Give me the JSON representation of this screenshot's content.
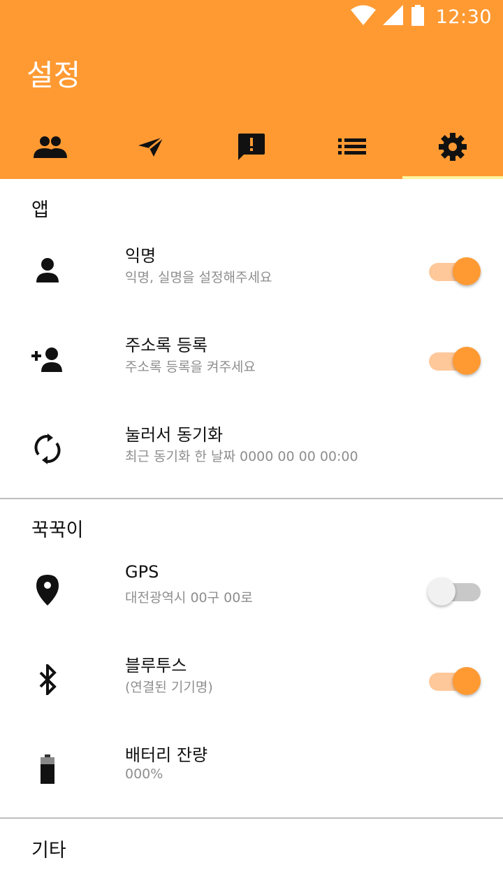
{
  "colors": {
    "accent": "#ff9a33",
    "tab_indicator": "#fff59d",
    "switch_on_track": "#ffc89a",
    "switch_off_track": "#c8c8c8"
  },
  "status_bar": {
    "time": "12:30",
    "icons": [
      "wifi-icon",
      "signal-icon",
      "battery-icon"
    ]
  },
  "app_bar": {
    "title": "설정"
  },
  "tabs": [
    {
      "icon": "people-icon",
      "active": false
    },
    {
      "icon": "send-icon",
      "active": false
    },
    {
      "icon": "feedback-icon",
      "active": false
    },
    {
      "icon": "list-icon",
      "active": false
    },
    {
      "icon": "settings-icon",
      "active": true
    }
  ],
  "sections": {
    "app": {
      "title": "앱",
      "items": [
        {
          "icon": "person-icon",
          "title": "익명",
          "subtitle": "익명, 실명을 설정해주세요",
          "toggle": true
        },
        {
          "icon": "person-add-icon",
          "title": "주소록 등록",
          "subtitle": "주소록 등록을 켜주세요",
          "toggle": true
        },
        {
          "icon": "sync-icon",
          "title": "눌러서 동기화",
          "subtitle": "최근 동기화 한 날짜 0000 00 00 00:00"
        }
      ]
    },
    "device": {
      "title": "꾹꾹이",
      "items": [
        {
          "icon": "location-pin-icon",
          "title": "GPS",
          "subtitle": "대전광역시 00구 00로",
          "toggle": false
        },
        {
          "icon": "bluetooth-icon",
          "title": "블루투스",
          "subtitle": "(연결된 기기명)",
          "toggle": true
        },
        {
          "icon": "battery-icon",
          "title": "배터리 잔량",
          "subtitle": "000%"
        }
      ]
    },
    "other": {
      "title": "기타"
    }
  }
}
